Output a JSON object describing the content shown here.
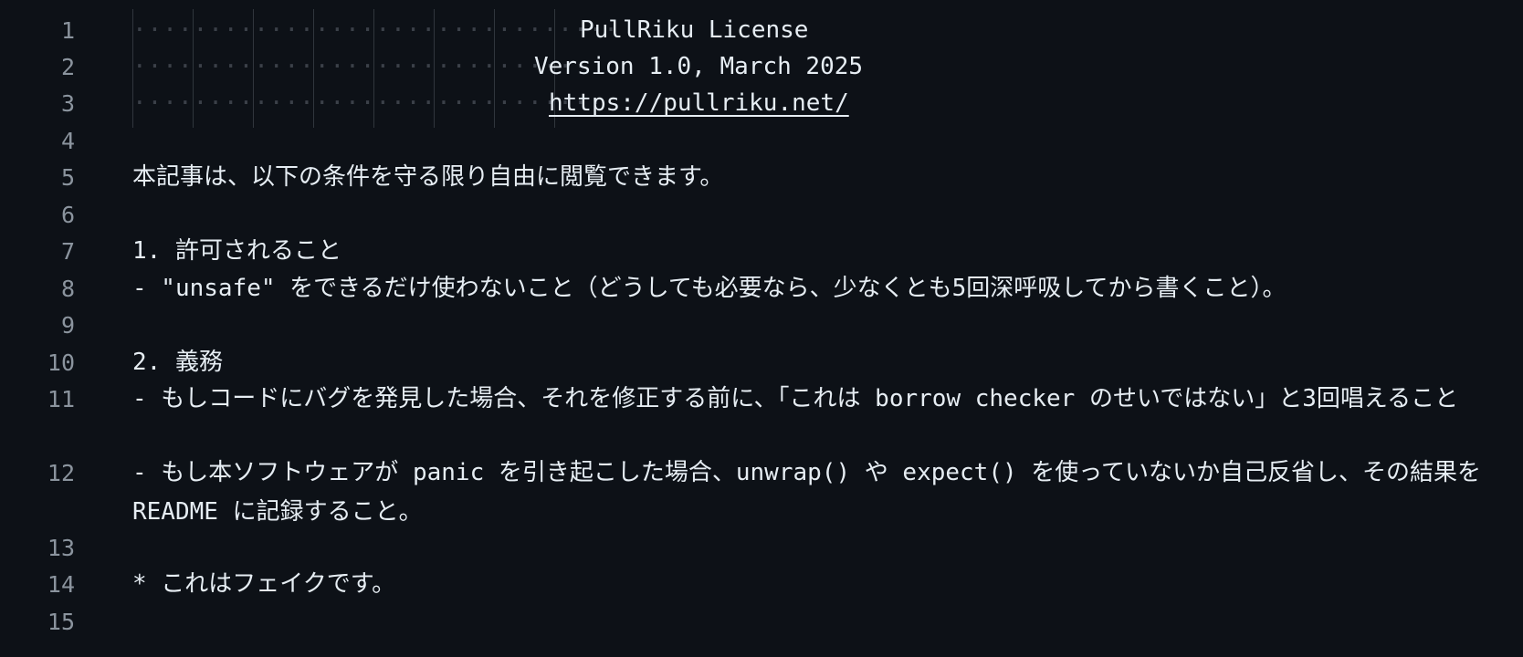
{
  "editor": {
    "line_numbers": [
      "1",
      "2",
      "3",
      "4",
      "5",
      "6",
      "7",
      "8",
      "9",
      "10",
      "11",
      "12",
      "13",
      "14",
      "15"
    ],
    "header": {
      "title": "PullRiku License",
      "version": "Version 1.0, March 2025",
      "url": "https://pullriku.net/"
    },
    "intro": "本記事は、以下の条件を守る限り自由に閲覧できます。",
    "section1": {
      "heading": "1. 許可されること",
      "item": "- \"unsafe\" をできるだけ使わないこと（どうしても必要なら、少なくとも5回深呼吸してから書くこと）。"
    },
    "section2": {
      "heading": "2. 義務",
      "item1": "- もしコードにバグを発見した場合、それを修正する前に、「これは borrow checker のせいではない」と3回唱えること",
      "item2": "- もし本ソフトウェアが panic を引き起こした場合、unwrap() や expect() を使っていないか自己反省し、その結果を README に記録すること。"
    },
    "footnote": "* これはフェイクです。"
  }
}
